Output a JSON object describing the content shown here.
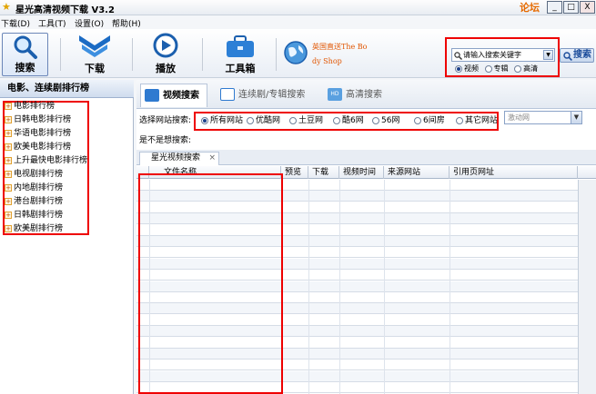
{
  "window": {
    "title": "星光高清视频下载 V3.2",
    "forum_link": "论坛",
    "controls": {
      "minimize": "_",
      "maximize": "□",
      "close": "X"
    }
  },
  "menu": [
    "下载(D)",
    "工具(T)",
    "设置(O)",
    "帮助(H)"
  ],
  "toolbar": {
    "search_label": "搜索",
    "download_label": "下载",
    "play_label": "播放",
    "toolbox_label": "工具箱",
    "promo_line1": "英国直送The Bo",
    "promo_line2": "dy Shop"
  },
  "search": {
    "placeholder": "请输入搜索关键字",
    "button_label": "搜索",
    "options": [
      "视频",
      "专辑",
      "高清"
    ],
    "selected": "视频"
  },
  "sidebar": {
    "header": "电影、连续剧排行榜",
    "items": [
      "电影排行榜",
      "日韩电影排行榜",
      "华语电影排行榜",
      "欧美电影排行榜",
      "上升最快电影排行榜",
      "电视剧排行榜",
      "内地剧排行榜",
      "港台剧排行榜",
      "日韩剧排行榜",
      "欧美剧排行榜"
    ]
  },
  "tabs": [
    {
      "label": "视频搜索",
      "active": true
    },
    {
      "label": "连续剧/专辑搜索",
      "active": false
    },
    {
      "label": "高清搜索",
      "active": false
    }
  ],
  "filter": {
    "site_label": "选择网站搜索:",
    "sites": [
      "所有网站",
      "优酷网",
      "土豆网",
      "酷6网",
      "56网",
      "6间房",
      "其它网站"
    ],
    "selected_site": "所有网站",
    "site_combo_value": "激动网",
    "want_label": "是不是想搜索:"
  },
  "results_tab": {
    "label": "星光视频搜索",
    "close": "×"
  },
  "columns": [
    "文件名称",
    "预览",
    "下载",
    "视频时间",
    "来源网站",
    "引用页网址"
  ],
  "colors": {
    "highlight": "#e00000",
    "accent": "#1a4b9a",
    "forum": "#e66a00"
  }
}
